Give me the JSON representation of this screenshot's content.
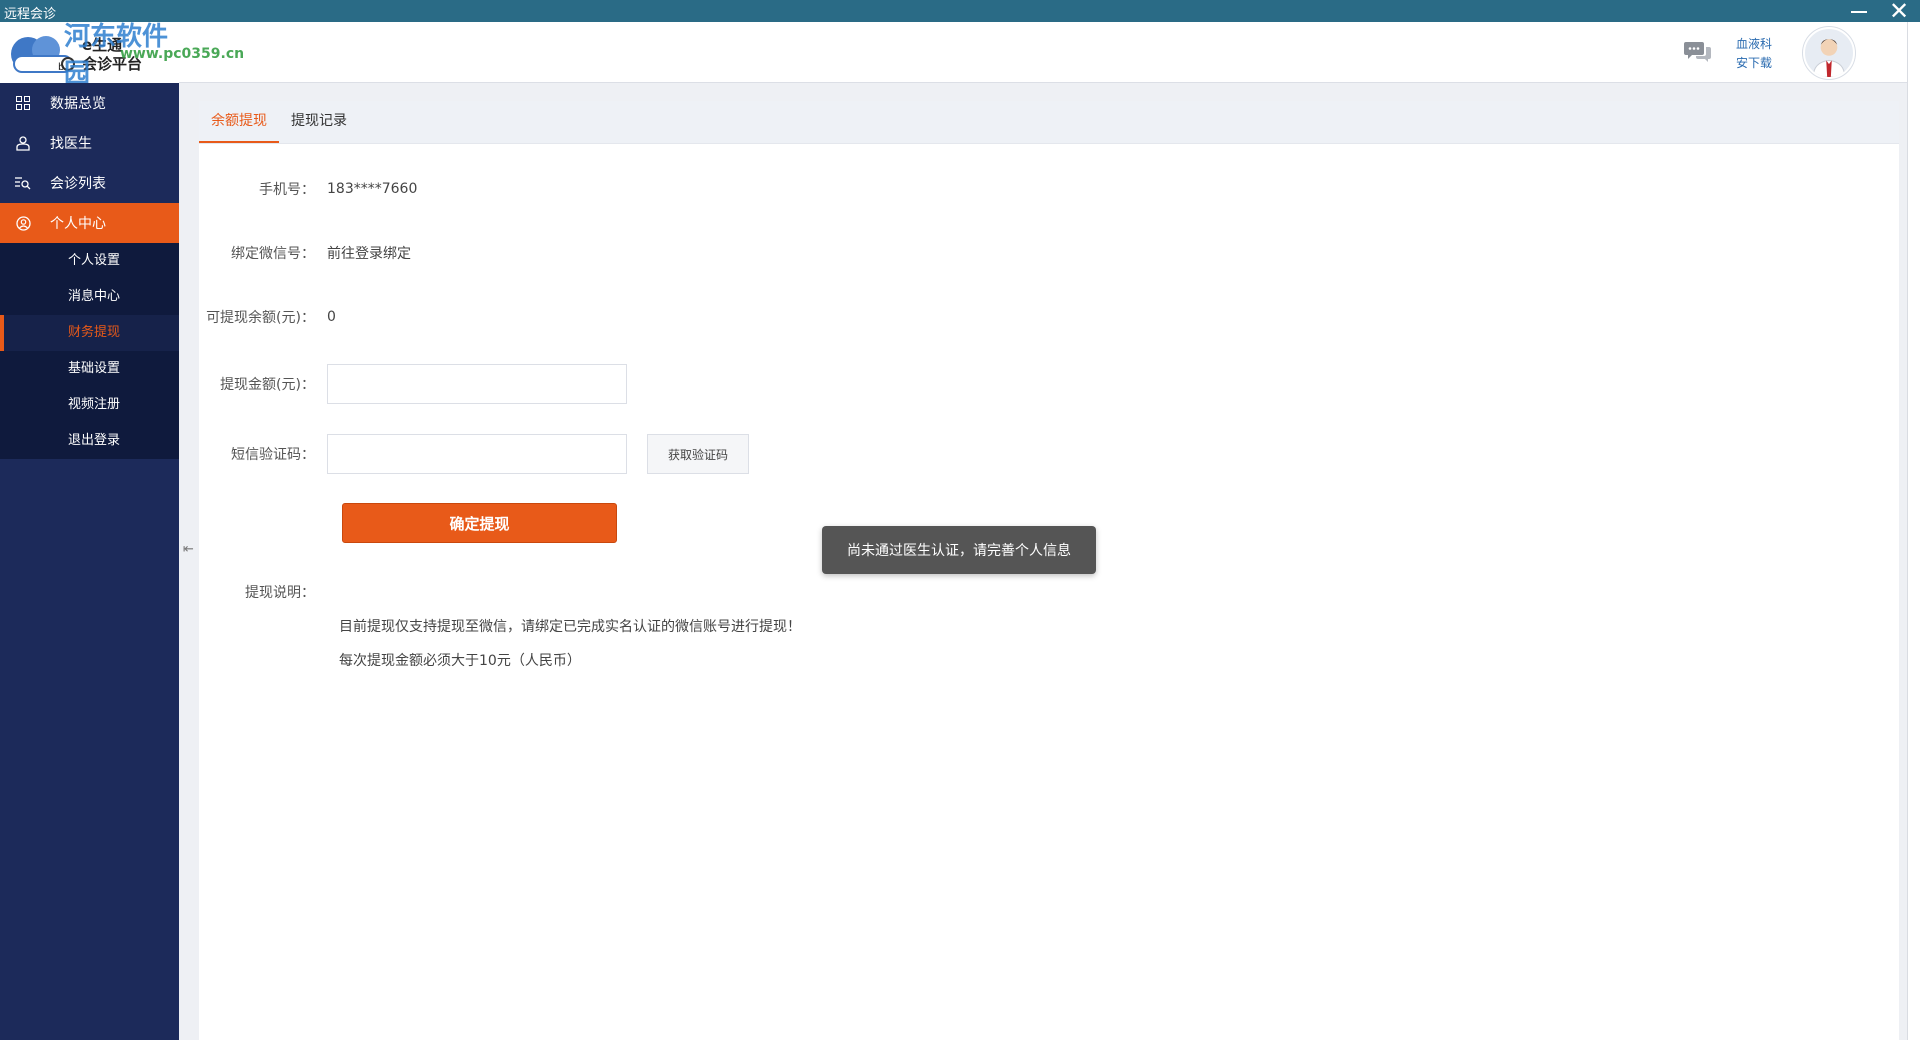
{
  "window": {
    "title": "远程会诊"
  },
  "brand": {
    "line1": "e生通",
    "line2": "会诊平台",
    "watermark_name": "河东软件园",
    "watermark_url": "www.pc0359.cn"
  },
  "header": {
    "department": "血液科",
    "download": "安下载"
  },
  "sidebar": {
    "items": [
      {
        "label": "数据总览",
        "icon": "grid-icon"
      },
      {
        "label": "找医生",
        "icon": "doctor-icon"
      },
      {
        "label": "会诊列表",
        "icon": "list-search-icon"
      },
      {
        "label": "个人中心",
        "icon": "user-circle-icon",
        "active": true
      }
    ],
    "subitems": [
      {
        "label": "个人设置"
      },
      {
        "label": "消息中心"
      },
      {
        "label": "财务提现",
        "active": true
      },
      {
        "label": "基础设置"
      },
      {
        "label": "视频注册"
      },
      {
        "label": "退出登录"
      }
    ]
  },
  "tabs": [
    {
      "label": "余额提现",
      "active": true
    },
    {
      "label": "提现记录"
    }
  ],
  "form": {
    "phone_label": "手机号：",
    "phone_value": "183****7660",
    "wechat_label": "绑定微信号：",
    "wechat_value": "前往登录绑定",
    "balance_label": "可提现余额(元)：",
    "balance_value": "0",
    "amount_label": "提现金额(元)：",
    "amount_value": "",
    "sms_label": "短信验证码：",
    "sms_value": "",
    "get_code_button": "获取验证码",
    "submit_button": "确定提现"
  },
  "notes": {
    "label": "提现说明：",
    "lines": [
      "目前提现仅支持提现至微信，请绑定已完成实名认证的微信账号进行提现！",
      "每次提现金额必须大于10元（人民币）"
    ]
  },
  "toast": {
    "message": "尚未通过医生认证，请完善个人信息"
  },
  "colors": {
    "accent": "#e85a19",
    "sidebar": "#1c2a5a",
    "titlebar": "#2a6b86",
    "link": "#2a6bb0"
  }
}
